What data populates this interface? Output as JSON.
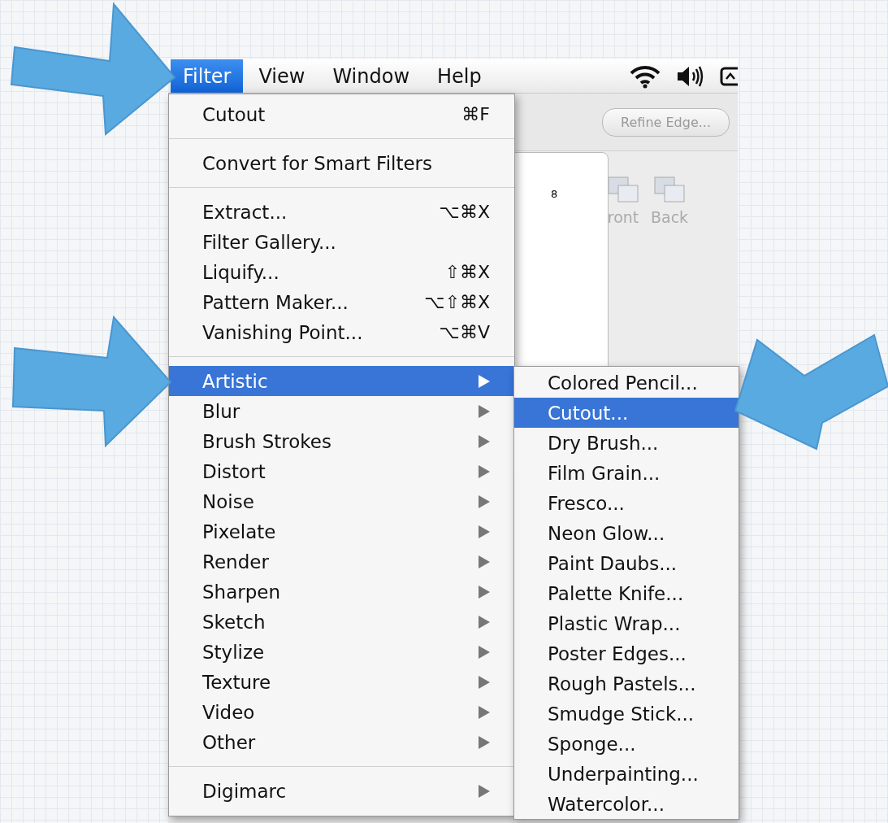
{
  "menu_bar": {
    "items": [
      {
        "label": "Filter",
        "selected": true
      },
      {
        "label": "View",
        "selected": false
      },
      {
        "label": "Window",
        "selected": false
      },
      {
        "label": "Help",
        "selected": false
      }
    ]
  },
  "toolbar": {
    "refine_button": "Refine Edge...",
    "arrange_buttons": [
      "ront",
      "Back"
    ],
    "ruler_label": "8"
  },
  "filter_menu": {
    "items": [
      {
        "kind": "item",
        "label": "Cutout",
        "shortcut": "⌘F",
        "selected": false
      },
      {
        "kind": "separator"
      },
      {
        "kind": "item",
        "label": "Convert for Smart Filters",
        "selected": false
      },
      {
        "kind": "separator"
      },
      {
        "kind": "item",
        "label": "Extract...",
        "shortcut": "⌥⌘X",
        "selected": false
      },
      {
        "kind": "item",
        "label": "Filter Gallery...",
        "selected": false
      },
      {
        "kind": "item",
        "label": "Liquify...",
        "shortcut": "⇧⌘X",
        "selected": false
      },
      {
        "kind": "item",
        "label": "Pattern Maker...",
        "shortcut": "⌥⇧⌘X",
        "selected": false
      },
      {
        "kind": "item",
        "label": "Vanishing Point...",
        "shortcut": "⌥⌘V",
        "selected": false
      },
      {
        "kind": "separator"
      },
      {
        "kind": "submenu",
        "label": "Artistic",
        "selected": true
      },
      {
        "kind": "submenu",
        "label": "Blur",
        "selected": false
      },
      {
        "kind": "submenu",
        "label": "Brush Strokes",
        "selected": false
      },
      {
        "kind": "submenu",
        "label": "Distort",
        "selected": false
      },
      {
        "kind": "submenu",
        "label": "Noise",
        "selected": false
      },
      {
        "kind": "submenu",
        "label": "Pixelate",
        "selected": false
      },
      {
        "kind": "submenu",
        "label": "Render",
        "selected": false
      },
      {
        "kind": "submenu",
        "label": "Sharpen",
        "selected": false
      },
      {
        "kind": "submenu",
        "label": "Sketch",
        "selected": false
      },
      {
        "kind": "submenu",
        "label": "Stylize",
        "selected": false
      },
      {
        "kind": "submenu",
        "label": "Texture",
        "selected": false
      },
      {
        "kind": "submenu",
        "label": "Video",
        "selected": false
      },
      {
        "kind": "submenu",
        "label": "Other",
        "selected": false
      },
      {
        "kind": "separator"
      },
      {
        "kind": "submenu",
        "label": "Digimarc",
        "selected": false
      }
    ]
  },
  "artistic_submenu": {
    "items": [
      {
        "label": "Colored Pencil...",
        "selected": false
      },
      {
        "label": "Cutout...",
        "selected": true
      },
      {
        "label": "Dry Brush...",
        "selected": false
      },
      {
        "label": "Film Grain...",
        "selected": false
      },
      {
        "label": "Fresco...",
        "selected": false
      },
      {
        "label": "Neon Glow...",
        "selected": false
      },
      {
        "label": "Paint Daubs...",
        "selected": false
      },
      {
        "label": "Palette Knife...",
        "selected": false
      },
      {
        "label": "Plastic Wrap...",
        "selected": false
      },
      {
        "label": "Poster Edges...",
        "selected": false
      },
      {
        "label": "Rough Pastels...",
        "selected": false
      },
      {
        "label": "Smudge Stick...",
        "selected": false
      },
      {
        "label": "Sponge...",
        "selected": false
      },
      {
        "label": "Underpainting...",
        "selected": false
      },
      {
        "label": "Watercolor...",
        "selected": false
      }
    ]
  }
}
